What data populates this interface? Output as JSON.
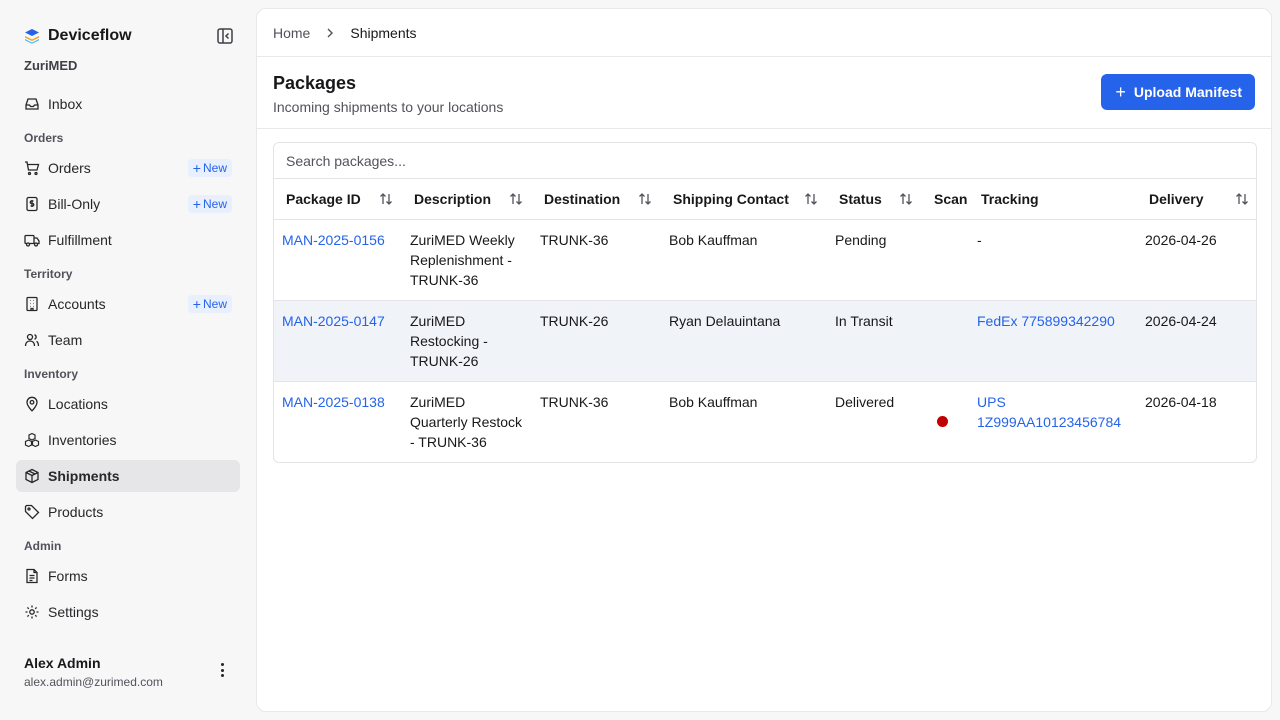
{
  "app": {
    "name": "Deviceflow",
    "org": "ZuriMED"
  },
  "sidebar": {
    "items": [
      {
        "label": "Inbox"
      },
      {
        "section": "Orders"
      },
      {
        "label": "Orders",
        "badge": "New"
      },
      {
        "label": "Bill-Only",
        "badge": "New"
      },
      {
        "label": "Fulfillment"
      },
      {
        "section": "Territory"
      },
      {
        "label": "Accounts",
        "badge": "New"
      },
      {
        "label": "Team"
      },
      {
        "section": "Inventory"
      },
      {
        "label": "Locations"
      },
      {
        "label": "Inventories"
      },
      {
        "label": "Shipments",
        "active": true
      },
      {
        "label": "Products"
      },
      {
        "section": "Admin"
      },
      {
        "label": "Forms"
      },
      {
        "label": "Settings"
      }
    ],
    "user": {
      "name": "Alex Admin",
      "email": "alex.admin@zurimed.com"
    }
  },
  "breadcrumb": {
    "home": "Home",
    "current": "Shipments"
  },
  "header": {
    "title": "Packages",
    "subtitle": "Incoming shipments to your locations",
    "upload_label": "Upload Manifest"
  },
  "search": {
    "placeholder": "Search packages..."
  },
  "table": {
    "columns": [
      "Package ID",
      "Description",
      "Destination",
      "Shipping Contact",
      "Status",
      "Scan",
      "Tracking",
      "Delivery"
    ],
    "rows": [
      {
        "id": "MAN-2025-0156",
        "description": "ZuriMED Weekly Replenishment - TRUNK-36",
        "destination": "TRUNK-36",
        "contact": "Bob Kauffman",
        "status": "Pending",
        "scan": false,
        "tracking": "-",
        "tracking_link": false,
        "delivery": "2026-04-26"
      },
      {
        "id": "MAN-2025-0147",
        "description": "ZuriMED Restocking - TRUNK-26",
        "destination": "TRUNK-26",
        "contact": "Ryan Delauintana",
        "status": "In Transit",
        "scan": false,
        "tracking": "FedEx 775899342290",
        "tracking_link": true,
        "delivery": "2026-04-24"
      },
      {
        "id": "MAN-2025-0138",
        "description": "ZuriMED Quarterly Restock - TRUNK-36",
        "destination": "TRUNK-36",
        "contact": "Bob Kauffman",
        "status": "Delivered",
        "scan": true,
        "tracking": "UPS 1Z999AA10123456784",
        "tracking_link": true,
        "delivery": "2026-04-18"
      }
    ]
  },
  "colors": {
    "accent": "#2563eb",
    "scan_dot": "#c00000",
    "active_nav": "#e6e6e8"
  }
}
